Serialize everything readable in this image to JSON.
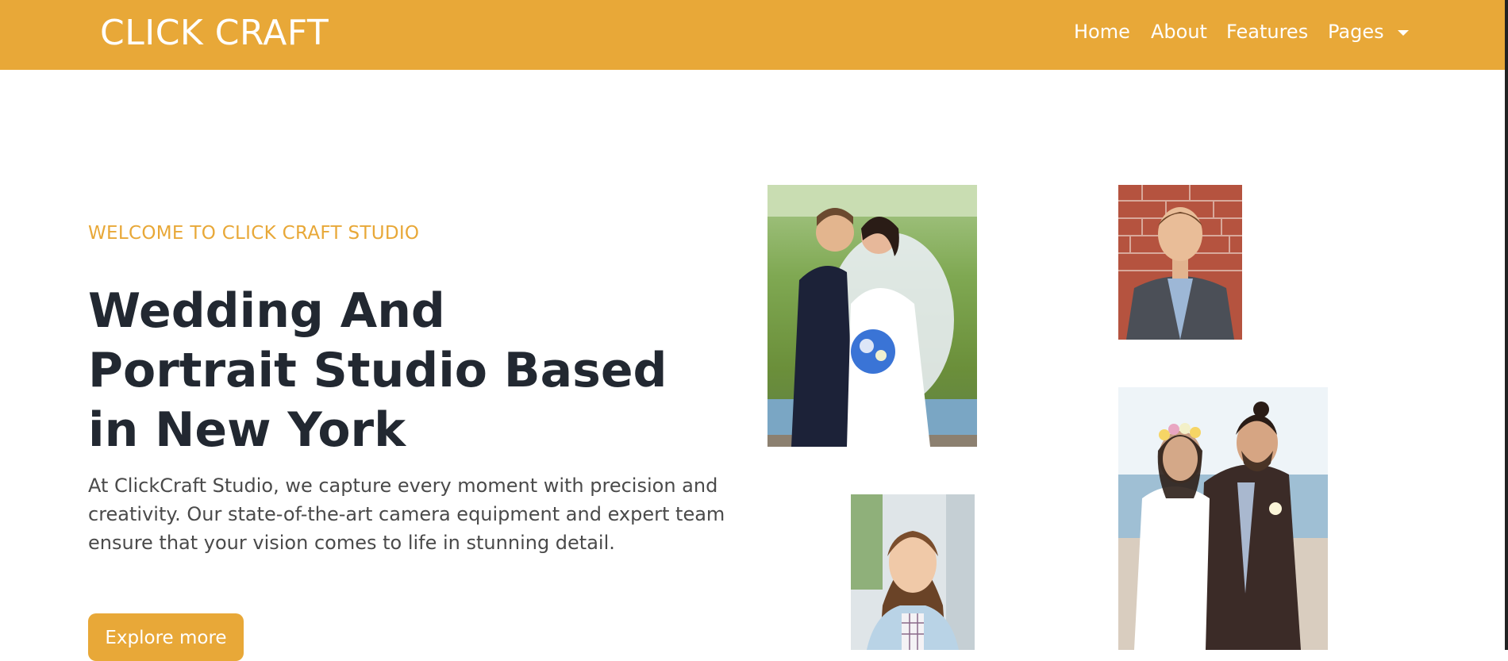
{
  "navbar": {
    "brand": "CLICK CRAFT",
    "links": [
      "Home",
      "About",
      "Features",
      "Pages"
    ]
  },
  "hero": {
    "eyebrow": "WELCOME TO CLICK CRAFT STUDIO",
    "headline_lines": [
      "Wedding And",
      "Portrait Studio Based",
      "in New York"
    ],
    "description_lines": [
      "At ClickCraft Studio, we capture every moment with precision and",
      "creativity. Our state-of-the-art camera equipment and expert team",
      "ensure that your vision comes to life in stunning detail."
    ],
    "button": "Explore more"
  },
  "colors": {
    "accent": "#e8a838",
    "heading": "#222831",
    "body_text": "#4a4a4a"
  }
}
